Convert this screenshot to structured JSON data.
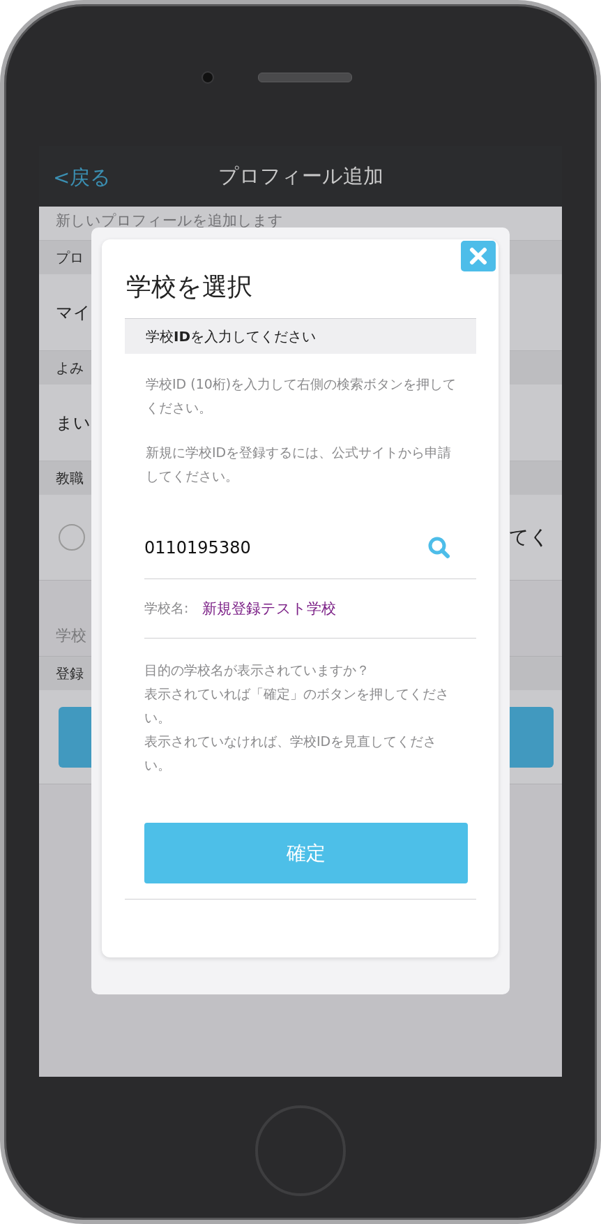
{
  "nav": {
    "back": "<戻る",
    "title": "プロフィール追加"
  },
  "background": {
    "description": "新しいプロフィールを追加します",
    "rows": [
      {
        "kind": "header",
        "text": "プロ"
      },
      {
        "kind": "field",
        "text": "マイ"
      },
      {
        "kind": "header",
        "text": "よみ"
      },
      {
        "kind": "field",
        "text": "まい"
      },
      {
        "kind": "header",
        "text": "教職"
      },
      {
        "kind": "radio",
        "selected": false,
        "text": "てく"
      },
      {
        "kind": "note",
        "text": "学校"
      },
      {
        "kind": "header",
        "text": "登録"
      },
      {
        "kind": "button"
      }
    ]
  },
  "dialog": {
    "title": "学校を選択",
    "section": "学校**ID**を入力してください",
    "instructions": [
      "学校ID (10桁)を入力して右側の検索ボタンを押してください。",
      "新規に学校IDを登録するには、公式サイトから申請してください。"
    ],
    "school_id": {
      "value": "0110195380"
    },
    "school_name": {
      "label": "学校名:",
      "value": "新規登録テスト学校"
    },
    "confirmation": [
      "目的の学校名が表示されていますか？",
      "表示されていれば「確定」のボタンを押してください。",
      "表示されていなければ、学校IDを見直してください。"
    ],
    "confirm_button": "確定"
  }
}
